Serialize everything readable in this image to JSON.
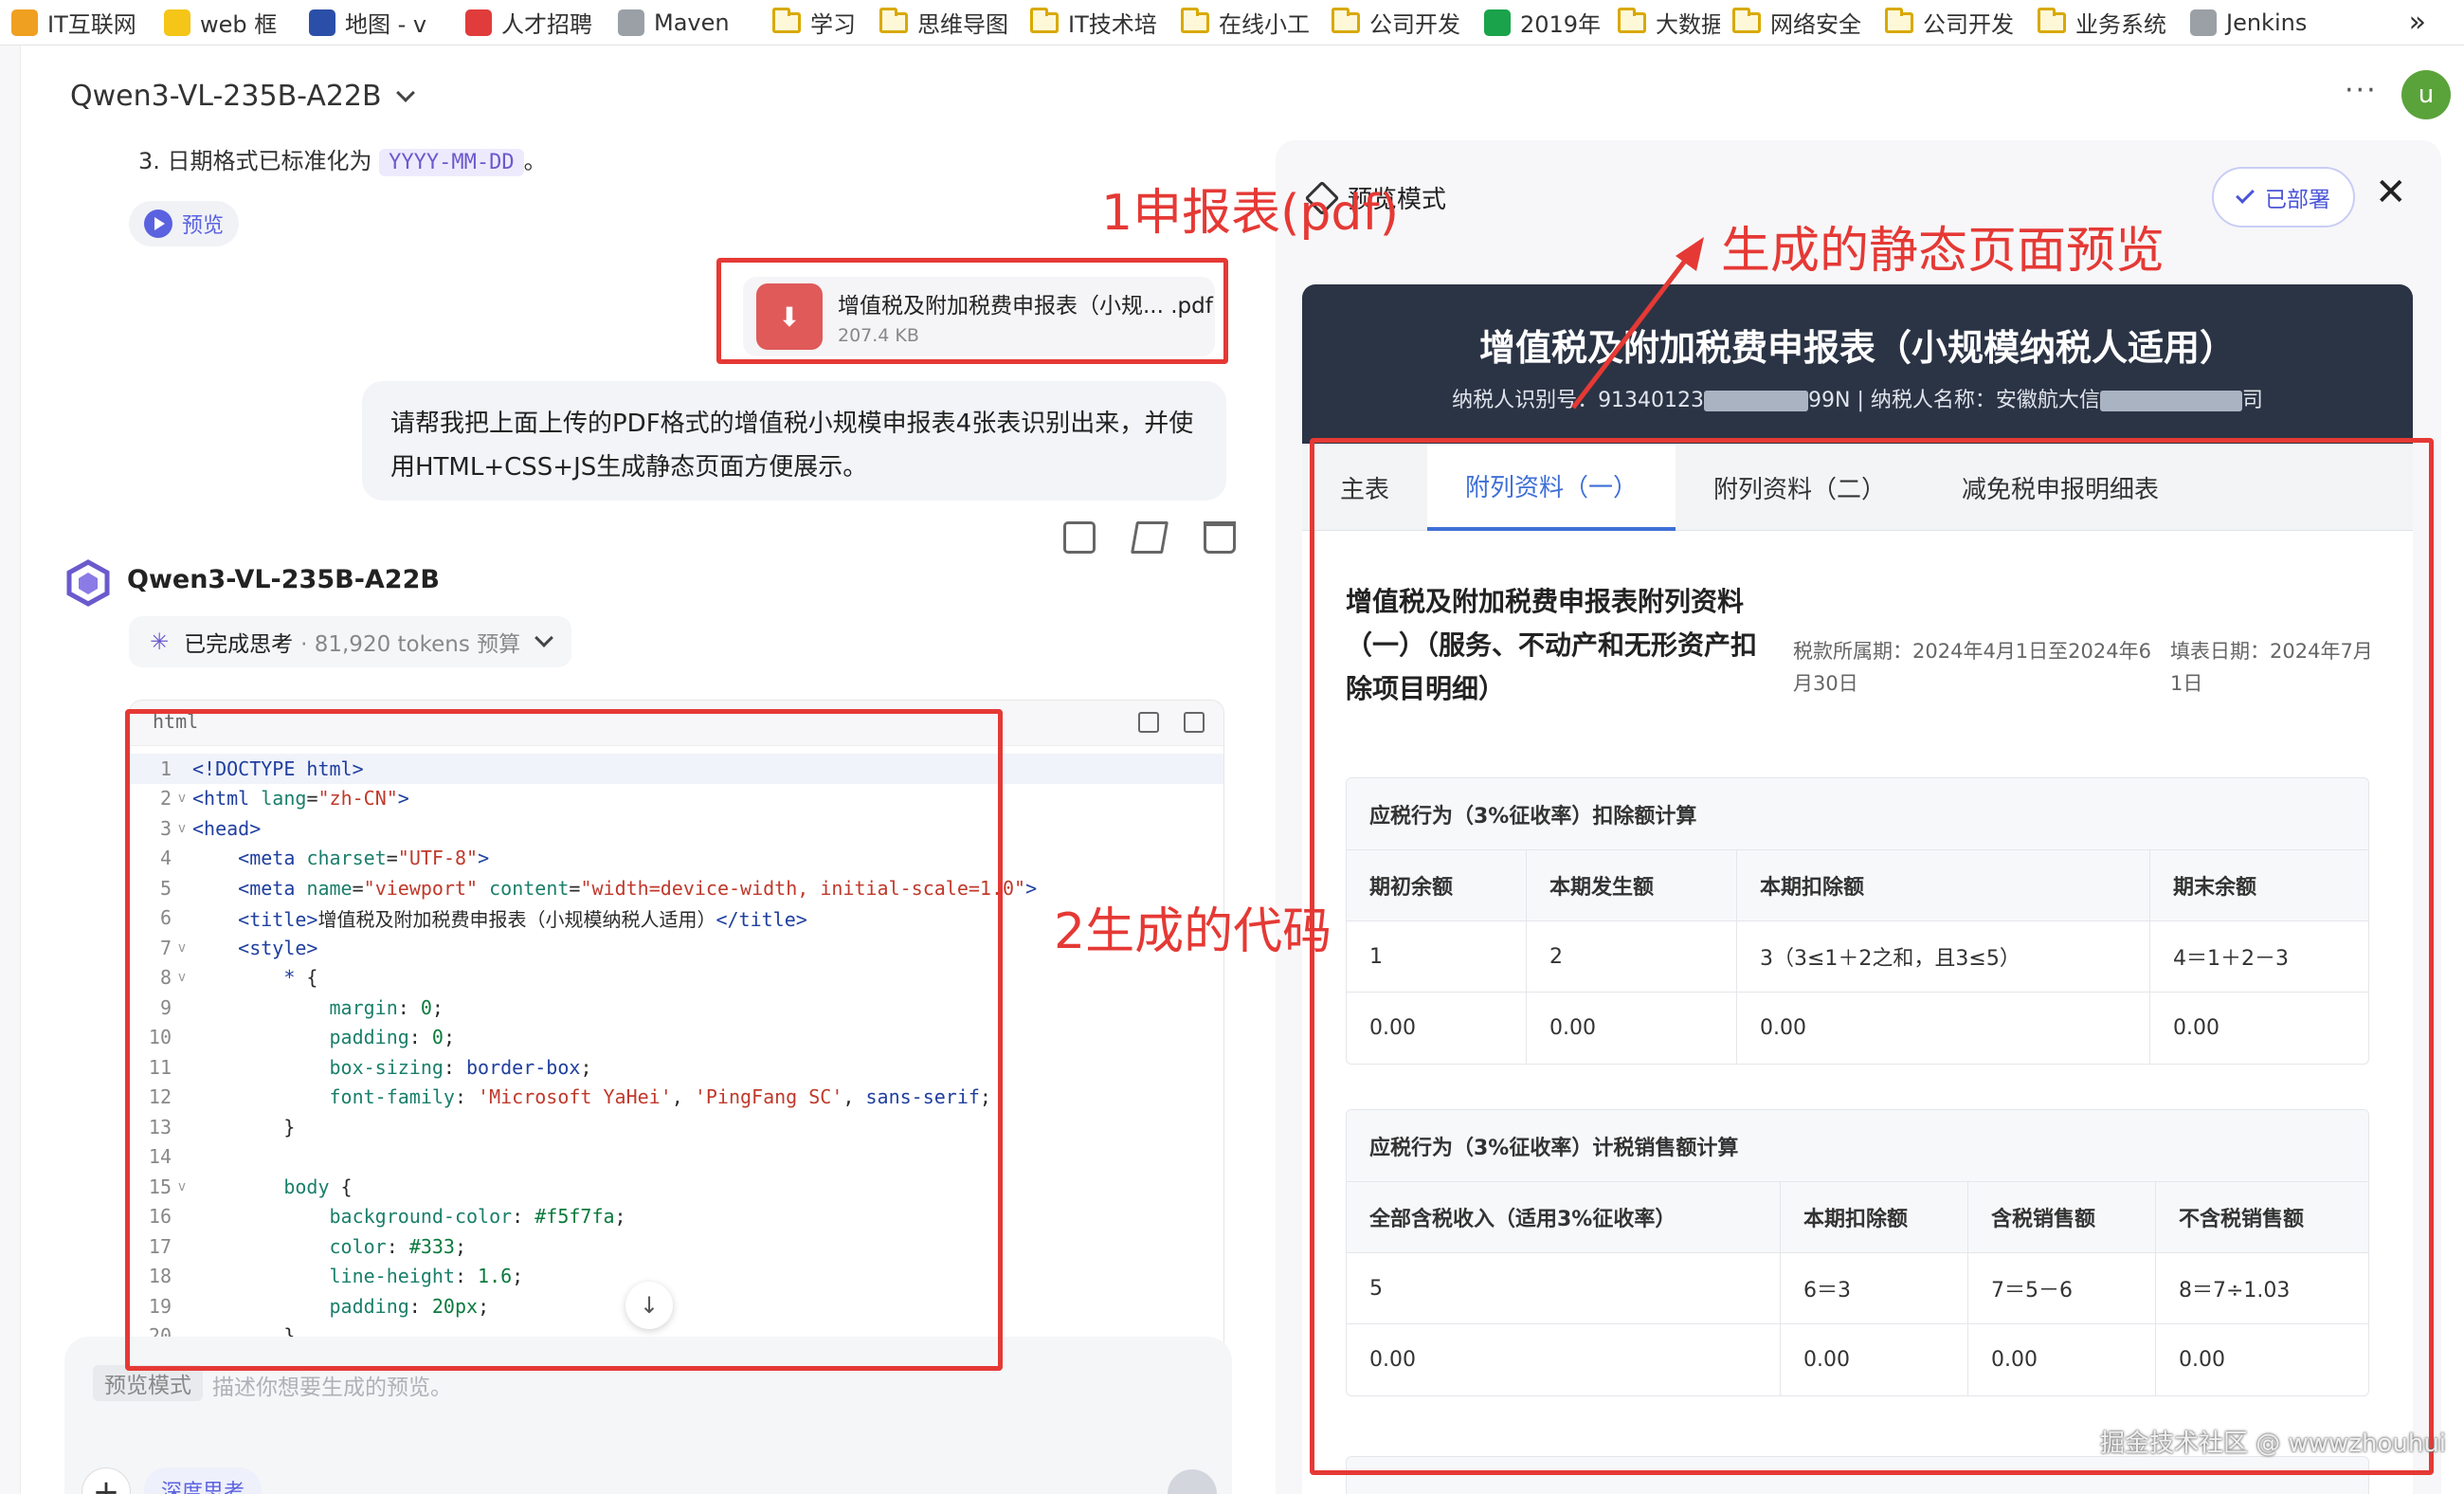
{
  "bookmarks": [
    {
      "label": "IT互联网",
      "kind": "site",
      "color": "#f0a020"
    },
    {
      "label": "web 框",
      "kind": "site",
      "color": "#f5c518"
    },
    {
      "label": "地图 - v",
      "kind": "site",
      "color": "#2b4fa8"
    },
    {
      "label": "人才招聘",
      "kind": "site",
      "color": "#e03c3c"
    },
    {
      "label": "Maven",
      "kind": "site",
      "color": "#9aa0a6"
    },
    {
      "label": "学习",
      "kind": "folder"
    },
    {
      "label": "思维导图",
      "kind": "folder"
    },
    {
      "label": "IT技术培",
      "kind": "folder"
    },
    {
      "label": "在线小工",
      "kind": "folder"
    },
    {
      "label": "公司开发",
      "kind": "folder"
    },
    {
      "label": "2019年",
      "kind": "site",
      "color": "#1aa34a"
    },
    {
      "label": "大数据",
      "kind": "folder"
    },
    {
      "label": "网络安全",
      "kind": "folder"
    },
    {
      "label": "公司开发",
      "kind": "folder"
    },
    {
      "label": "业务系统",
      "kind": "folder"
    },
    {
      "label": "Jenkins",
      "kind": "site",
      "color": "#9aa0a6"
    }
  ],
  "bookmarks_more": "»",
  "chat": {
    "model_selector": "Qwen3-VL-235B-A22B",
    "cut_line_prefix": "3.  日期格式已标准化为 ",
    "cut_line_code": "YYYY-MM-DD",
    "cut_line_suffix": "。",
    "preview_label": "预览",
    "file": {
      "name": "增值税及附加税费申报表（小规... .pdf",
      "size": "207.4 KB",
      "icon": "pdf-icon"
    },
    "user_message": "请帮我把上面上传的PDF格式的增值税小规模申报表4张表识别出来，并使用HTML+CSS+JS生成静态页面方便展示。",
    "model_name": "Qwen3-VL-235B-A22B",
    "thinking_label": "已完成思考",
    "thinking_tokens": "· 81,920 tokens 预算",
    "code_lang": "html",
    "input_tag": "预览模式",
    "input_placeholder": "描述你想要生成的预览。",
    "deep_think_label": "深度思考",
    "code_lines": [
      {
        "n": "1",
        "fold": "",
        "html": "<span class=\"t\">&lt;!DOCTYPE html&gt;</span>"
      },
      {
        "n": "2",
        "fold": "v",
        "html": "<span class=\"t\">&lt;html</span> <span class=\"p\">lang</span>=<span class=\"s\">\"zh-CN\"</span><span class=\"t\">&gt;</span>"
      },
      {
        "n": "3",
        "fold": "v",
        "html": "<span class=\"t\">&lt;head&gt;</span>"
      },
      {
        "n": "4",
        "fold": "",
        "html": "    <span class=\"t\">&lt;meta</span> <span class=\"p\">charset</span>=<span class=\"s\">\"UTF-8\"</span><span class=\"t\">&gt;</span>"
      },
      {
        "n": "5",
        "fold": "",
        "html": "    <span class=\"t\">&lt;meta</span> <span class=\"p\">name</span>=<span class=\"s\">\"viewport\"</span> <span class=\"p\">content</span>=<span class=\"s\">\"width=device-width, initial-scale=1.0\"</span><span class=\"t\">&gt;</span>"
      },
      {
        "n": "6",
        "fold": "",
        "html": "    <span class=\"t\">&lt;title&gt;</span>增值税及附加税费申报表（小规模纳税人适用）<span class=\"t\">&lt;/title&gt;</span>"
      },
      {
        "n": "7",
        "fold": "v",
        "html": "    <span class=\"t\">&lt;style&gt;</span>"
      },
      {
        "n": "8",
        "fold": "v",
        "html": "        <span class=\"t\">*</span> {"
      },
      {
        "n": "9",
        "fold": "",
        "html": "            <span class=\"p\">margin</span>: <span class=\"v\">0</span>;"
      },
      {
        "n": "10",
        "fold": "",
        "html": "            <span class=\"p\">padding</span>: <span class=\"v\">0</span>;"
      },
      {
        "n": "11",
        "fold": "",
        "html": "            <span class=\"p\">box-sizing</span>: <span class=\"t\">border-box</span>;"
      },
      {
        "n": "12",
        "fold": "",
        "html": "            <span class=\"p\">font-family</span>: <span class=\"s\">'Microsoft YaHei'</span>, <span class=\"s\">'PingFang SC'</span>, <span class=\"t\">sans-serif</span>;"
      },
      {
        "n": "13",
        "fold": "",
        "html": "        }"
      },
      {
        "n": "14",
        "fold": "",
        "html": ""
      },
      {
        "n": "15",
        "fold": "v",
        "html": "        <span class=\"p\">body</span> {"
      },
      {
        "n": "16",
        "fold": "",
        "html": "            <span class=\"p\">background-color</span>: <span class=\"v\">#f5f7fa</span>;"
      },
      {
        "n": "17",
        "fold": "",
        "html": "            <span class=\"p\">color</span>: <span class=\"v\">#333</span>;"
      },
      {
        "n": "18",
        "fold": "",
        "html": "            <span class=\"p\">line-height</span>: <span class=\"v\">1.6</span>;"
      },
      {
        "n": "19",
        "fold": "",
        "html": "            <span class=\"p\">padding</span>: <span class=\"v\">20px</span>;"
      },
      {
        "n": "20",
        "fold": "",
        "html": "        }"
      }
    ]
  },
  "preview": {
    "mode_label": "预览模式",
    "deployed_label": "已部署",
    "avatar_letter": "u",
    "doc_title": "增值税及附加税费申报表（小规模纳税人适用）",
    "taxpayer_id_prefix": "纳税人识别号：91340123",
    "taxpayer_id_suffix": "99N | 纳税人名称：安徽航大信",
    "taxpayer_name_suffix": "司",
    "tabs": [
      "主表",
      "附列资料（一）",
      "附列资料（二）",
      "减免税申报明细表"
    ],
    "active_tab": 1,
    "section_title": "增值税及附加税费申报表附列资料（一）（服务、不动产和无形资产扣除项目明细）",
    "period": "税款所属期：2024年4月1日至2024年6月30日",
    "fill_date": "填表日期：2024年7月1日",
    "table1": {
      "caption": "应税行为（3%征收率）扣除额计算",
      "headers": [
        "期初余额",
        "本期发生额",
        "本期扣除额",
        "期末余额"
      ],
      "rows": [
        [
          "1",
          "2",
          "3（3≤1＋2之和，且3≤5）",
          "4＝1＋2－3"
        ],
        [
          "0.00",
          "0.00",
          "0.00",
          "0.00"
        ]
      ]
    },
    "table2": {
      "caption": "应税行为（3%征收率）计税销售额计算",
      "headers": [
        "全部含税收入（适用3%征收率）",
        "本期扣除额",
        "含税销售额",
        "不含税销售额"
      ],
      "rows": [
        [
          "5",
          "6＝3",
          "7＝5－6",
          "8＝7÷1.03"
        ],
        [
          "0.00",
          "0.00",
          "0.00",
          "0.00"
        ]
      ]
    }
  },
  "annotations": {
    "label1": "1申报表(pdf)",
    "label2": "2生成的代码",
    "label3": "生成的静态页面预览",
    "color": "#e53935"
  },
  "watermark": "掘金技术社区 @ wwwzhouhui"
}
